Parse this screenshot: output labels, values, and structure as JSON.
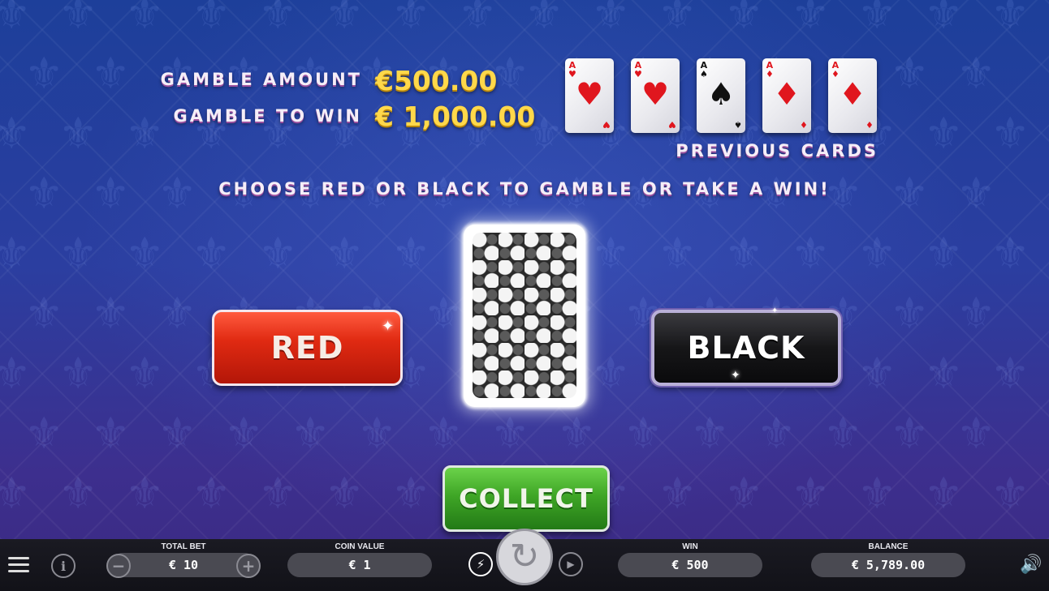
{
  "gamble": {
    "amount_label": "GAMBLE AMOUNT",
    "amount_value": "€500.00",
    "to_win_label": "GAMBLE TO WIN",
    "to_win_value": "€ 1,000.00"
  },
  "previous_cards": {
    "label": "PREVIOUS CARDS",
    "cards": [
      {
        "rank": "A",
        "suit": "♥",
        "color": "red"
      },
      {
        "rank": "A",
        "suit": "♥",
        "color": "red"
      },
      {
        "rank": "A",
        "suit": "♠",
        "color": "black"
      },
      {
        "rank": "A",
        "suit": "♦",
        "color": "red"
      },
      {
        "rank": "A",
        "suit": "♦",
        "color": "red"
      }
    ]
  },
  "instruction": "CHOOSE RED OR BLACK TO GAMBLE OR TAKE A WIN!",
  "buttons": {
    "red": "RED",
    "black": "BLACK",
    "collect": "COLLECT"
  },
  "bottom_bar": {
    "total_bet_label": "TOTAL BET",
    "total_bet_value": "€ 10",
    "coin_value_label": "COIN VALUE",
    "coin_value_value": "€ 1",
    "win_label": "WIN",
    "win_value": "€ 500",
    "balance_label": "BALANCE",
    "balance_value": "€ 5,789.00"
  },
  "icons": {
    "menu": "menu-icon",
    "info": "info-icon",
    "minus": "minus-icon",
    "plus": "plus-icon",
    "turbo": "lightning-icon",
    "spin": "spin-icon",
    "autoplay": "autoplay-icon",
    "sound": "speaker-icon"
  },
  "colors": {
    "red_suit": "#e0161e",
    "gold_text": "#ffd84a",
    "collect_green": "#3fa626",
    "red_button": "#e02a12",
    "background_blue": "#2b3ea0"
  }
}
